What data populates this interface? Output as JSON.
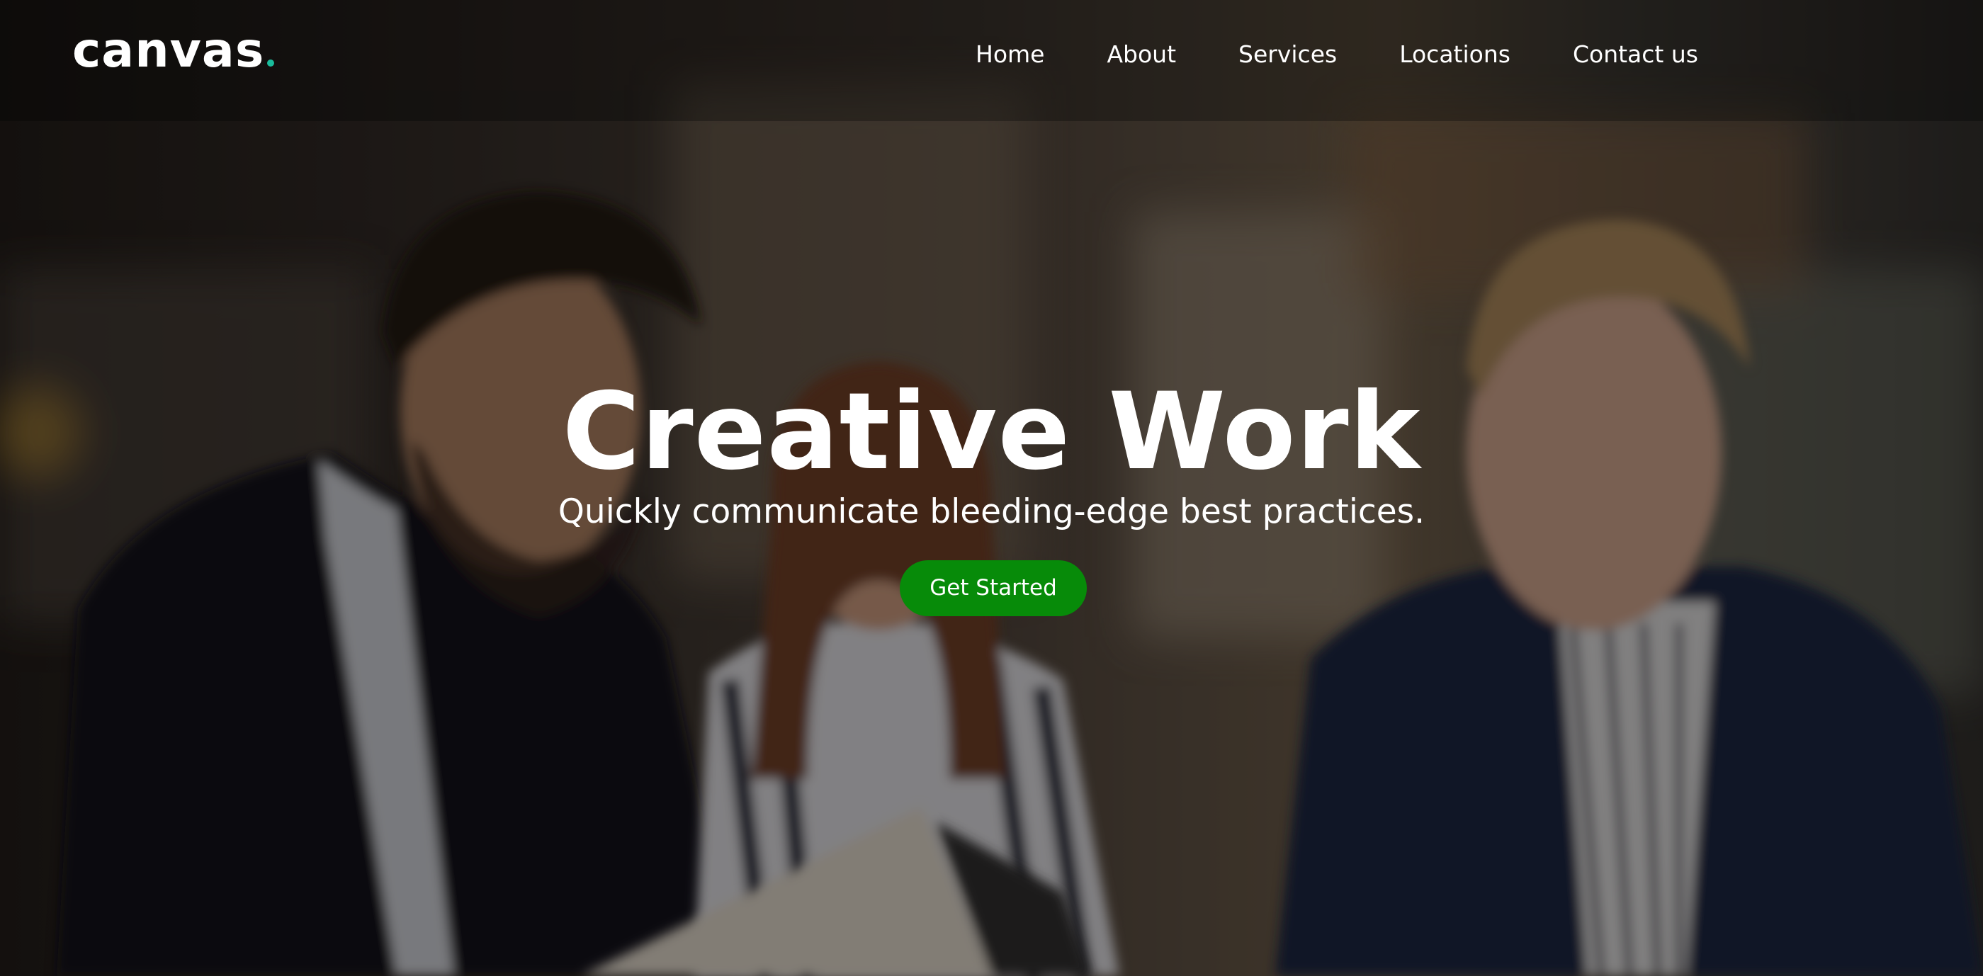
{
  "header": {
    "logo_text": "canvas",
    "logo_accent_color": "#1abc9c",
    "nav": [
      {
        "label": "Home"
      },
      {
        "label": "About"
      },
      {
        "label": "Services"
      },
      {
        "label": "Locations"
      },
      {
        "label": "Contact us"
      }
    ]
  },
  "hero": {
    "title": "Creative Work",
    "subtitle": "Quickly communicate bleeding-edge best practices.",
    "cta_label": "Get Started",
    "cta_color": "#078b09"
  }
}
